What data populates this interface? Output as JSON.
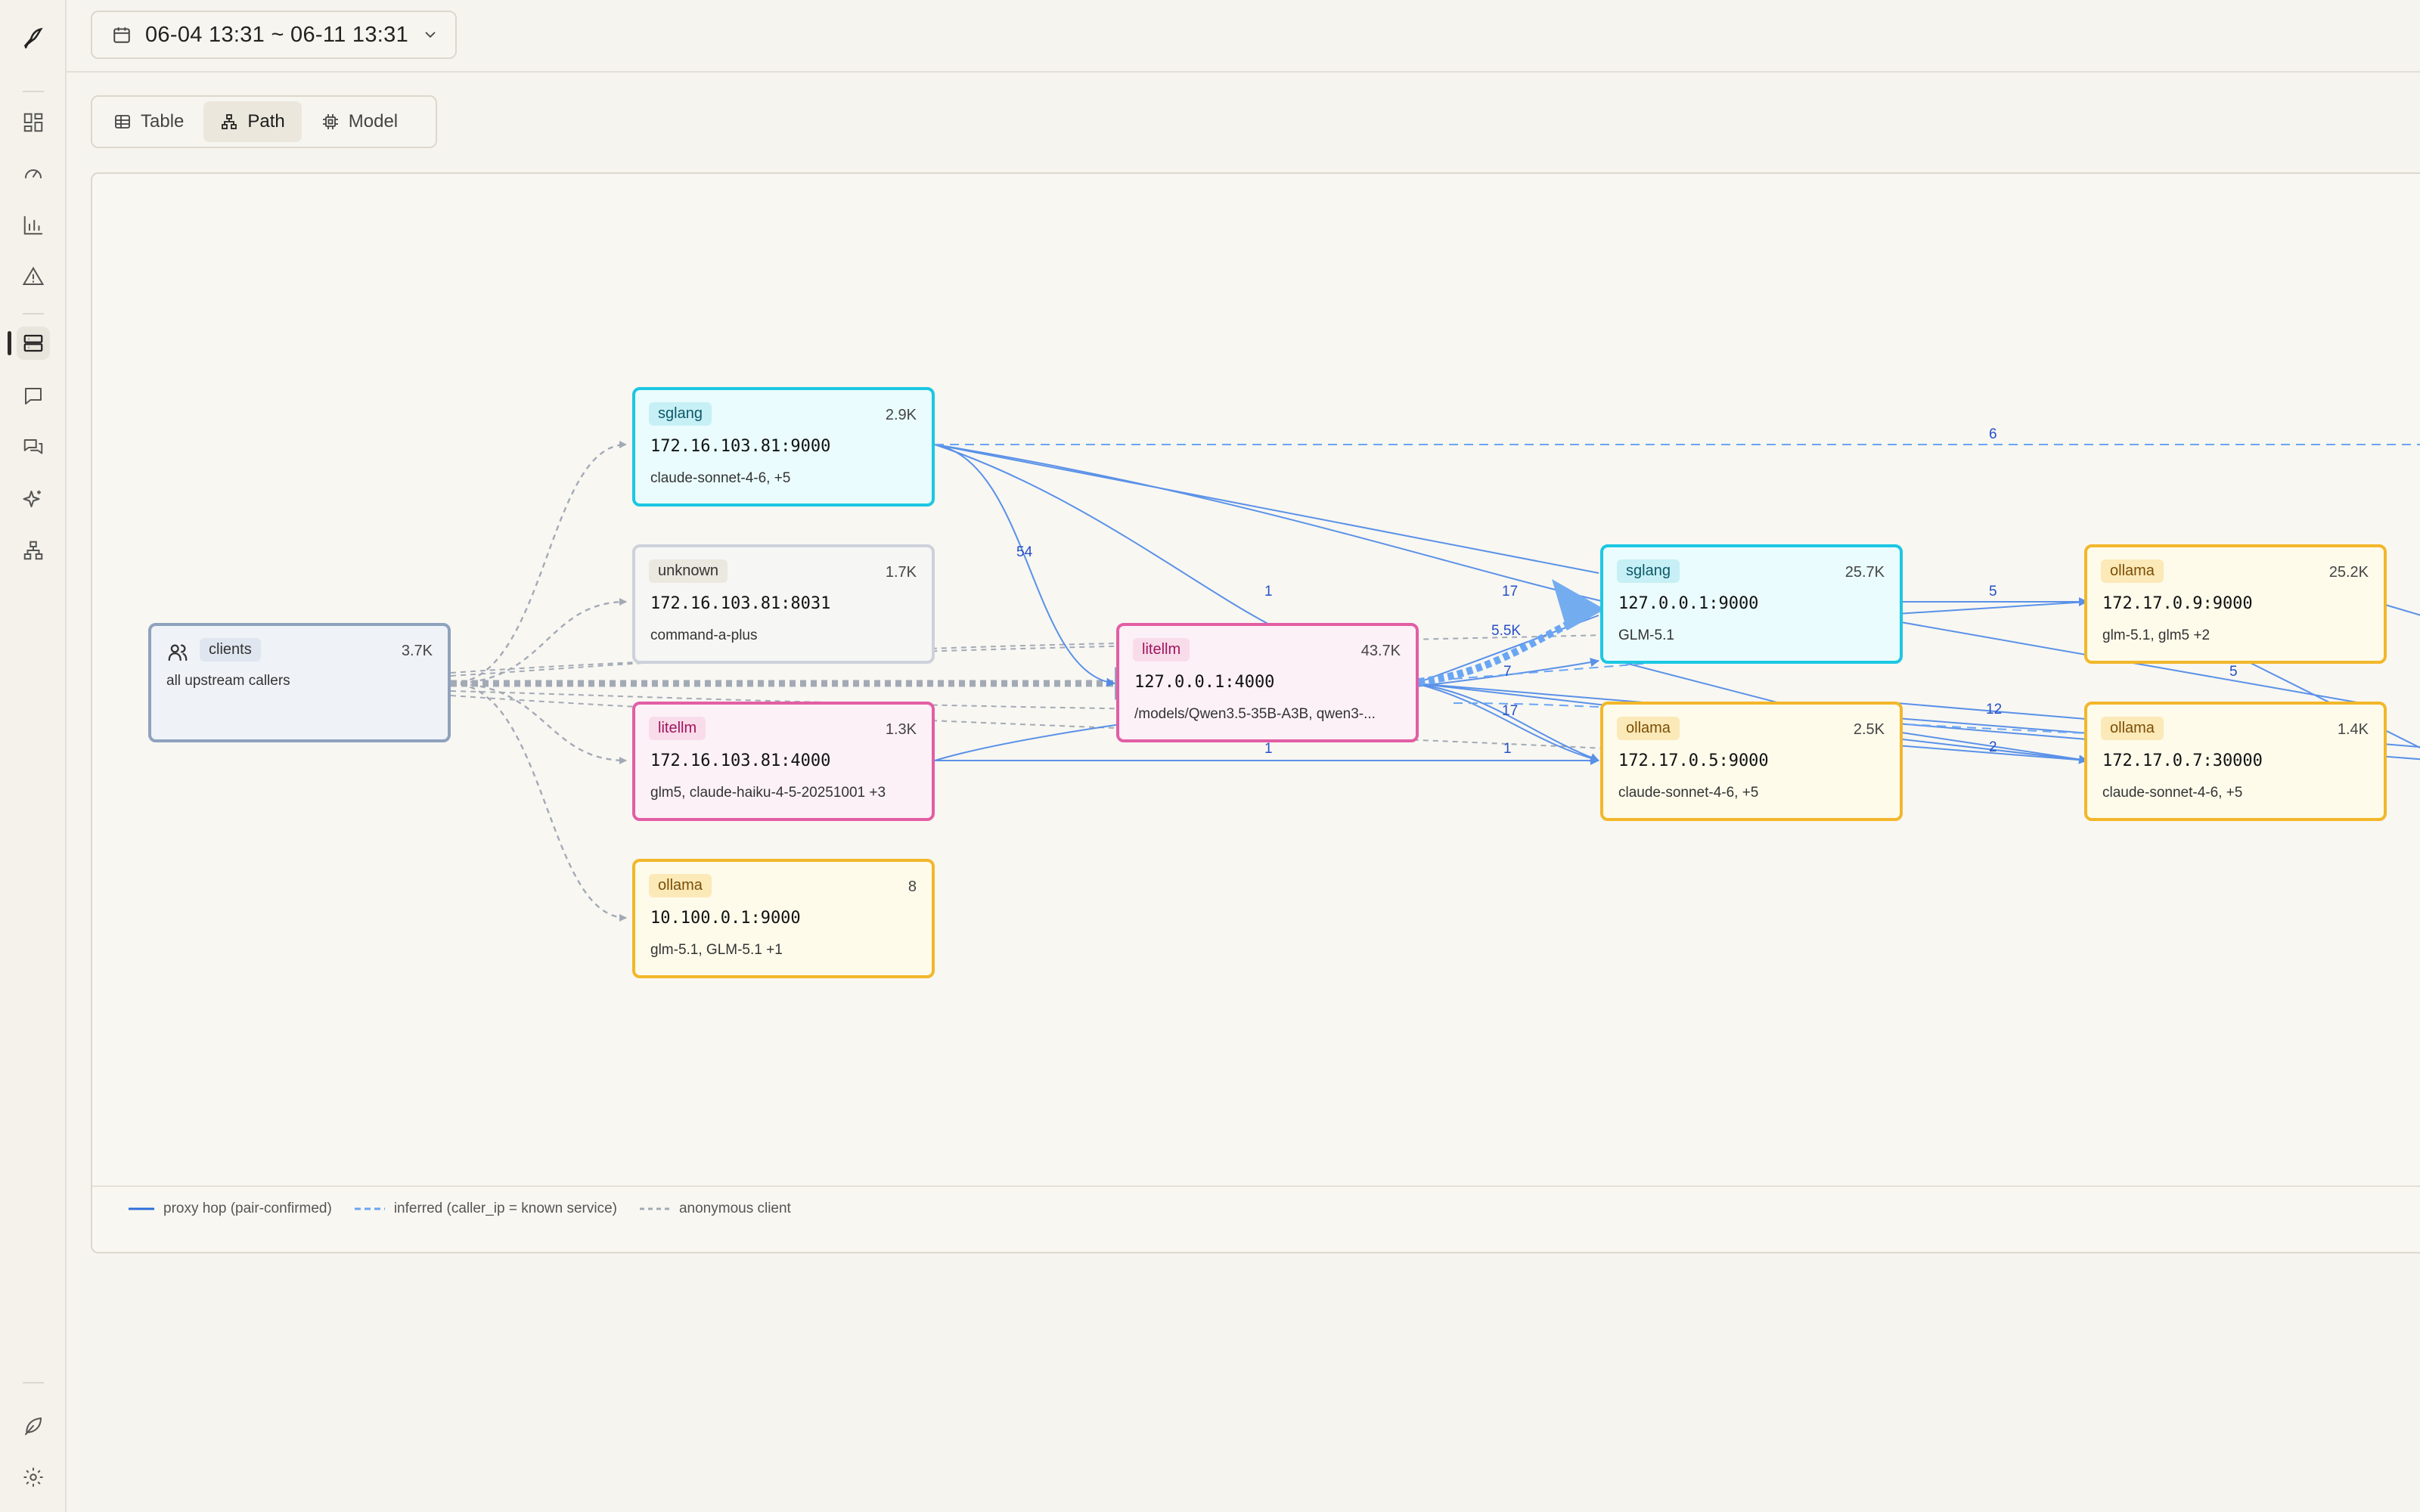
{
  "date_range": "06-04 13:31 ~ 06-11 13:31",
  "tabs": [
    {
      "label": "Table",
      "icon": "table-icon",
      "active": false
    },
    {
      "label": "Path",
      "icon": "path-icon",
      "active": true
    },
    {
      "label": "Model",
      "icon": "chip-icon",
      "active": false
    }
  ],
  "sidebar": {
    "logo": "bird-logo-icon",
    "items": [
      "dashboard-icon",
      "gauge-icon",
      "bar-chart-icon",
      "alert-icon",
      "servers-icon",
      "message-icon",
      "messages-icon",
      "sparkles-icon",
      "network-icon"
    ],
    "active": "servers-icon",
    "bottom": [
      "leaf-icon",
      "gear-icon"
    ]
  },
  "nodes": {
    "clients": {
      "tag": "clients",
      "count": "3.7K",
      "models": "all upstream callers"
    },
    "n1": {
      "tag": "sglang",
      "count": "2.9K",
      "addr": "172.16.103.81:9000",
      "models": "claude-sonnet-4-6, +5"
    },
    "n2": {
      "tag": "unknown",
      "count": "1.7K",
      "addr": "172.16.103.81:8031",
      "models": "command-a-plus"
    },
    "n3": {
      "tag": "litellm",
      "count": "1.3K",
      "addr": "172.16.103.81:4000",
      "models": "glm5, claude-haiku-4-5-20251001 +3"
    },
    "n4": {
      "tag": "ollama",
      "count": "8",
      "addr": "10.100.0.1:9000",
      "models": "glm-5.1, GLM-5.1 +1"
    },
    "n5": {
      "tag": "litellm",
      "count": "43.7K",
      "addr": "127.0.0.1:4000",
      "models": "/models/Qwen3.5-35B-A3B, qwen3-..."
    },
    "n6": {
      "tag": "sglang",
      "count": "25.7K",
      "addr": "127.0.0.1:9000",
      "models": "GLM-5.1"
    },
    "n7": {
      "tag": "ollama",
      "count": "2.5K",
      "addr": "172.17.0.5:9000",
      "models": "claude-sonnet-4-6, +5"
    },
    "n8": {
      "tag": "ollama",
      "count": "25.2K",
      "addr": "172.17.0.9:9000",
      "models": "glm-5.1, glm5 +2"
    },
    "n9": {
      "tag": "ollama",
      "count": "1.4K",
      "addr": "172.17.0.7:30000",
      "models": "claude-sonnet-4-6, +5"
    }
  },
  "edge_labels": {
    "e54": "54",
    "e1a": "1",
    "e17a": "17",
    "e55k": "5.5K",
    "e7": "7",
    "e17b": "17",
    "e1b": "1",
    "e1c": "1",
    "e6": "6",
    "e5a": "5",
    "e5b": "5",
    "e12": "12",
    "e2": "2"
  },
  "legend": {
    "proxy": "proxy hop (pair-confirmed)",
    "inferred": "inferred (caller_ip = known service)",
    "anon": "anonymous client"
  },
  "colors": {
    "sglang": "#1cc7e2",
    "litellm": "#e25ea5",
    "ollama": "#f2b72a",
    "unknown": "#cdd2da",
    "clients": "#8fa2be",
    "proxy_edge": "#4a86e8",
    "anon_edge": "#a3aab6"
  }
}
